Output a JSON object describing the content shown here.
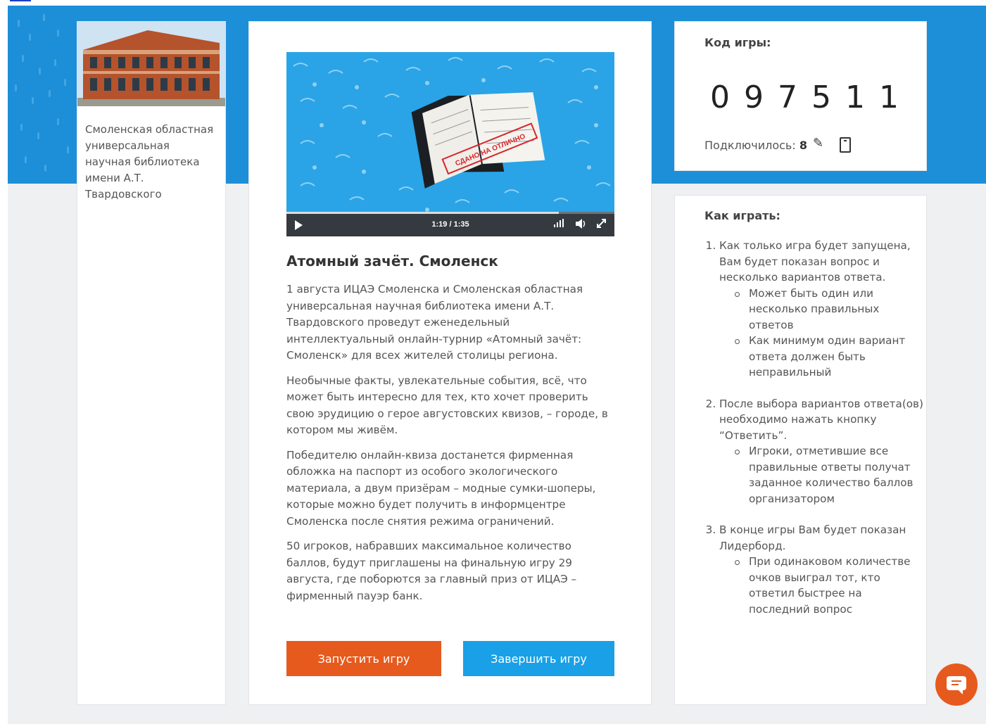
{
  "library": {
    "name": "Смоленская областная универсальная научная библиотека имени А.Т. Твардовского"
  },
  "video": {
    "time": "1:19 / 1:35",
    "progress_fraction": 0.83,
    "stamp_text": "СДАНО НА ОТЛИЧНО"
  },
  "game": {
    "title": "Атомный зачёт. Смоленск",
    "paragraphs": [
      "1 августа ИЦАЭ Смоленска и Смоленская областная универсальная научная библиотека имени А.Т. Твардовского проведут еженедельный интеллектуальный онлайн-турнир «Атомный зачёт: Смоленск» для всех жителей столицы региона.",
      "Необычные факты, увлекательные события, всё, что может быть интересно для тех, кто хочет проверить свою эрудицию о герое августовских квизов, – городе, в котором мы живём.",
      "Победителю онлайн-квиза достанется фирменная обложка на паспорт из особого экологического материала, а двум призёрам – модные сумки-шоперы, которые можно будет получить в информцентре Смоленска после снятия режима ограничений.",
      "50 игроков, набравших максимальное количество баллов, будут приглашены на финальную игру 29 августа, где поборются за главный приз от ИЦАЭ – фирменный пауэр банк."
    ],
    "start_label": "Запустить игру",
    "stop_label": "Завершить игру"
  },
  "code": {
    "label": "Код игры:",
    "digits": "097511",
    "connected_label": "Подключилось:",
    "connected_count": "8"
  },
  "howto": {
    "title": "Как играть:",
    "steps": [
      {
        "text": "Как только игра будет запущена, Вам будет показан вопрос и несколько вариантов ответа.",
        "subs": [
          "Может быть один или несколько правильных ответов",
          "Как минимум один вариант ответа должен быть неправильный"
        ]
      },
      {
        "text": "После выбора вариантов ответа(ов) необходимо нажать кнопку “Ответить”.",
        "subs": [
          "Игроки, отметившие все правильные ответы получат заданное количество баллов организатором"
        ]
      },
      {
        "text": "В конце игры Вам будет показан Лидерборд.",
        "subs": [
          "При одинаковом количестве очков выиграл тот, кто ответил быстрее на последний вопрос"
        ]
      }
    ]
  },
  "colors": {
    "banner": "#1c8fd8",
    "start_button": "#e65a1e",
    "stop_button": "#1aa0e6",
    "chat_button": "#e65a1e"
  }
}
